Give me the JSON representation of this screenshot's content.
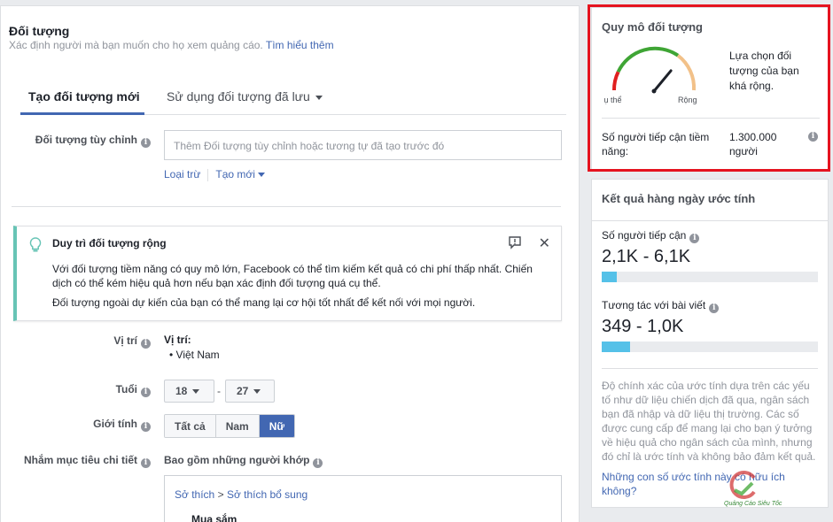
{
  "audience": {
    "title": "Đối tượng",
    "subtitle": "Xác định người mà bạn muốn cho họ xem quảng cáo.",
    "learn_more": "Tìm hiểu thêm",
    "tabs": {
      "new": "Tạo đối tượng mới",
      "saved": "Sử dụng đối tượng đã lưu"
    },
    "custom": {
      "label": "Đối tượng tùy chỉnh",
      "placeholder": "Thêm Đối tượng tùy chỉnh hoặc tương tự đã tạo trước đó",
      "exclude": "Loại trừ",
      "create_new": "Tạo mới"
    },
    "notice": {
      "title": "Duy trì đối tượng rộng",
      "body1": "Với đối tượng tiềm năng có quy mô lớn, Facebook có thể tìm kiếm kết quả có chi phí thấp nhất. Chiến dịch có thể kém hiệu quả hơn nếu bạn xác định đối tượng quá cụ thể.",
      "body2": "Đối tượng ngoài dự kiến của bạn có thể mang lại cơ hội tốt nhất để kết nối với mọi người."
    },
    "location": {
      "label": "Vị trí",
      "heading": "Vị trí:",
      "item": "Việt Nam"
    },
    "age": {
      "label": "Tuổi",
      "min": "18",
      "max": "27",
      "dash": "-"
    },
    "gender": {
      "label": "Giới tính",
      "options": [
        "Tất cả",
        "Nam",
        "Nữ"
      ],
      "selected": "Nữ"
    },
    "detailed": {
      "label": "Nhắm mục tiêu chi tiết",
      "include": "Bao gồm những người khớp",
      "crumb1": "Sở thích",
      "crumb_sep": ">",
      "crumb2": "Sở thích bổ sung",
      "category": "Mua sắm"
    }
  },
  "audience_size": {
    "title": "Quy mô đối tượng",
    "specific": "Cụ thể",
    "broad": "Rộng",
    "description": "Lựa chọn đối tượng của bạn khá rộng.",
    "reach_label": "Số người tiếp cận tiềm năng:",
    "reach_value": "1.300.000 người",
    "gauge_level": 0.72
  },
  "daily_results": {
    "title": "Kết quả hàng ngày ước tính",
    "reach_label": "Số người tiếp cận",
    "reach_value": "2,1K - 6,1K",
    "reach_fill": 0.07,
    "engagement_label": "Tương tác với bài viết",
    "engagement_value": "349 - 1,0K",
    "engagement_fill": 0.13,
    "note": "Độ chính xác của ước tính dựa trên các yếu tố như dữ liệu chiến dịch đã qua, ngân sách bạn đã nhập và dữ liệu thị trường. Các số được cung cấp để mang lại cho bạn ý tưởng về hiệu quả cho ngân sách của mình, nhưng đó chỉ là ước tính và không bảo đảm kết quả.",
    "helpful": "Những con số ước tính này có hữu ích không?"
  },
  "watermark": {
    "text": "Quảng Cáo Siêu Tốc"
  },
  "colors": {
    "accent": "#4267b2",
    "highlight": "#e5131f",
    "bar": "#55c1e8",
    "notice": "#67c4b5"
  }
}
